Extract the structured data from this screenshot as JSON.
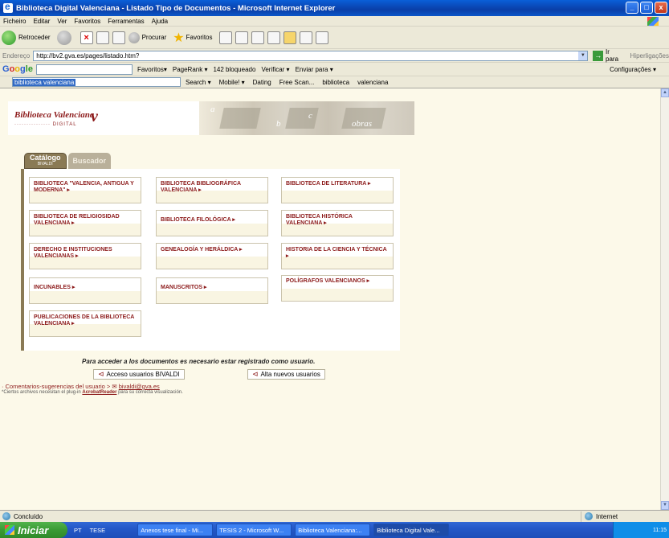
{
  "window": {
    "title": "Biblioteca Digital Valenciana - Listado Tipo de Documentos - Microsoft Internet Explorer",
    "buttons": [
      "_",
      "□",
      "x"
    ]
  },
  "menu": [
    "Ficheiro",
    "Editar",
    "Ver",
    "Favoritos",
    "Ferramentas",
    "Ajuda"
  ],
  "toolbar": {
    "back_label": "Retroceder",
    "search_label": "Procurar",
    "favorites_label": "Favoritos"
  },
  "address": {
    "label": "Endereço",
    "url": "http://bv2.gva.es/pages/listado.htm?",
    "go_label": "Ir para",
    "links_label": "Hiperligações"
  },
  "googlebar": {
    "logo_parts": [
      "G",
      "o",
      "o",
      "g",
      "le"
    ],
    "items": [
      "Favoritos▾",
      "PageRank ▾",
      "142 bloqueado",
      "Verificar ▾",
      "Enviar para ▾"
    ],
    "settings_label": "Configurações ▾"
  },
  "linksbar": {
    "search_text": "biblioteca valenciana",
    "items": [
      "Search ▾",
      "Mobile! ▾",
      "Dating",
      "Free Scan...",
      "biblioteca",
      "valenciana"
    ]
  },
  "site": {
    "logo_title": "Biblioteca Valenciana",
    "logo_sub": "··············· DIGITAL",
    "logo_mark": "v",
    "banner_letters": [
      "a",
      "b",
      "c",
      "obras"
    ]
  },
  "tabs": {
    "catalog": "Catálogo",
    "catalog_sub": "BIVALDI",
    "search": "Buscador"
  },
  "categories": [
    "BIBLIOTECA \"VALENCIA, ANTIGUA Y MODERNA\"",
    "BIBLIOTECA BIBLIOGRÁFICA VALENCIANA",
    "BIBLIOTECA DE LITERATURA",
    "BIBLIOTECA DE RELIGIOSIDAD VALENCIANA",
    "BIBLIOTECA FILOLÓGICA",
    "BIBLIOTECA HISTÓRICA VALENCIANA",
    "DERECHO E INSTITUCIONES VALENCIANAS",
    "GENEALOGÍA Y HERÁLDICA",
    "HISTORIA DE LA CIENCIA Y TÉCNICA",
    "INCUNABLES",
    "MANUSCRITOS",
    "POLÍGRAFOS VALENCIANOS",
    "PUBLICACIONES DE LA BIBLIOTECA VALENCIANA"
  ],
  "notice": "Para acceder a los documentos es necesario estar registrado como usuario.",
  "buttons": {
    "access": "Acceso usuarios BIVALDI",
    "register": "Alta nuevos usuarios"
  },
  "comments": {
    "text": "· Comentarios-sugerencias del usuario >",
    "email": "bivaldi@gva.es"
  },
  "note": {
    "prefix": "*Ciertos archivos necesitan el plug-in",
    "link": "AcrobatReader",
    "suffix": "para su correcta visualización."
  },
  "status": {
    "text": "Concluído",
    "zone": "Internet"
  },
  "taskbar": {
    "start": "Iniciar",
    "quick": [
      "PT",
      "TESE"
    ],
    "tasks": [
      "Anexos tese final - Mi...",
      "TESIS 2 - Microsoft W...",
      "Biblioteca Valenciana:...",
      "Biblioteca Digital Vale..."
    ],
    "clock": "11:15"
  }
}
